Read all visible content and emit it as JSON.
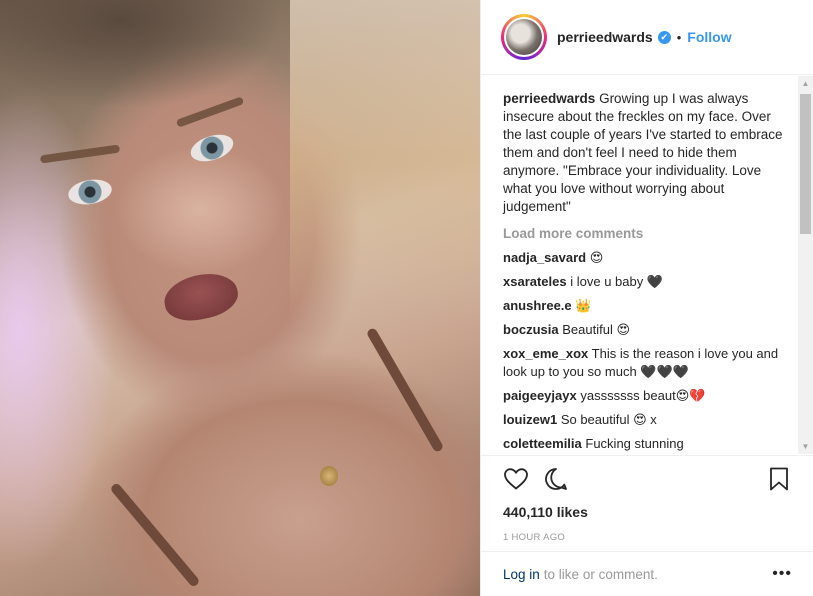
{
  "post": {
    "username": "perrieedwards",
    "separator": "•",
    "follow_label": "Follow",
    "verified_mark": "✔",
    "caption_user": "perrieedwards",
    "caption_text": "Growing up I was always insecure about the freckles on my face. Over the last couple of years I've started to embrace them and don't feel I need to hide them anymore. \"Embrace your individuality. Love what you love without worrying about judgement\"",
    "load_more": "Load more comments",
    "comments": [
      {
        "user": "nadja_savard",
        "text": "😍"
      },
      {
        "user": "xsarateles",
        "text": "i love u baby 🖤"
      },
      {
        "user": "anushree.e",
        "text": "👑"
      },
      {
        "user": "boczusia",
        "text": "Beautiful 😍"
      },
      {
        "user": "xox_eme_xox",
        "text": "This is the reason i love you and look up to you so much 🖤🖤🖤"
      },
      {
        "user": "paigeeyjayx",
        "text": "yasssssss beaut😍💔"
      },
      {
        "user": "louizew1",
        "text": "So beautiful 😍 x"
      },
      {
        "user": "coletteemilia",
        "text": "Fucking stunning"
      }
    ],
    "likes": "440,110 likes",
    "timestamp": "1 HOUR AGO",
    "login_link": "Log in",
    "login_suffix": "to like or comment.",
    "more_dots": "•••",
    "scroll_up": "▲",
    "scroll_down": "▼"
  },
  "icons": {
    "like": "heart-icon",
    "comment": "comment-icon",
    "save": "bookmark-icon",
    "verified": "verified-badge-icon"
  },
  "colors": {
    "accent": "#3897f0",
    "muted": "#999999",
    "text": "#262626"
  }
}
